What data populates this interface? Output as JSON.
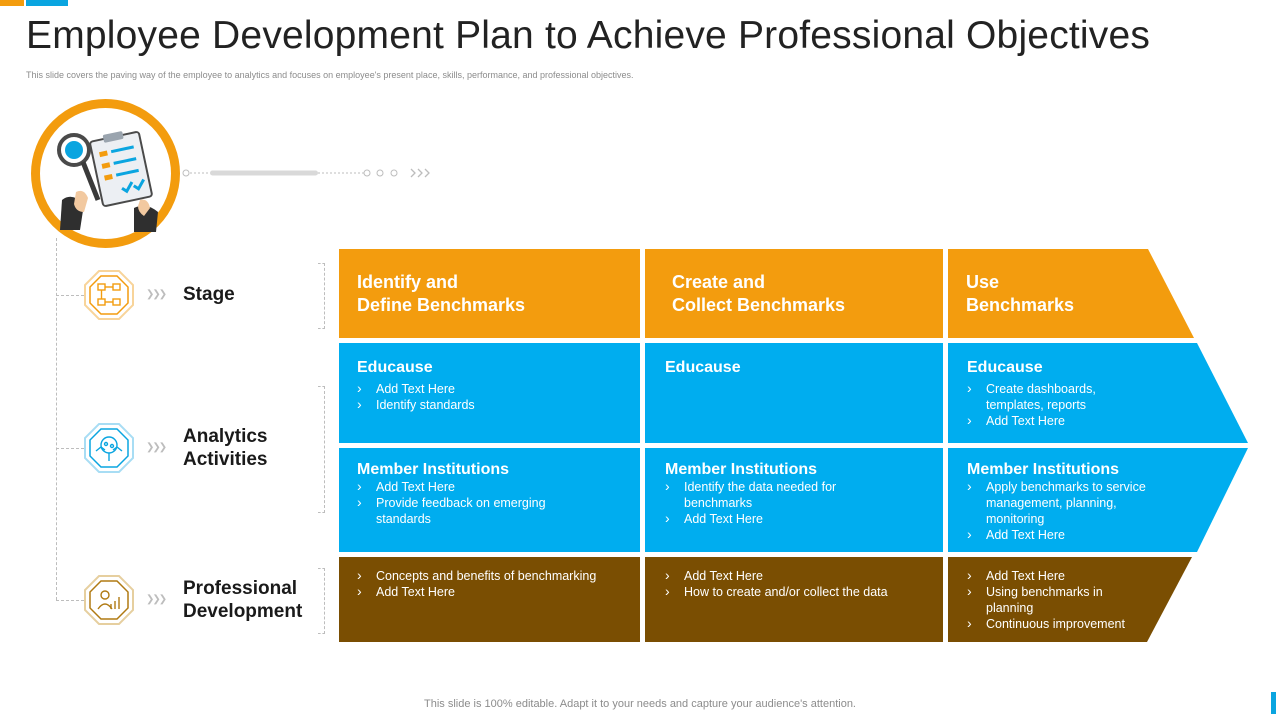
{
  "title": "Employee Development Plan to Achieve Professional Objectives",
  "subtitle": "This slide covers the paving way of the employee to analytics and focuses on employee's present place, skills, performance, and professional objectives.",
  "footer": "This slide is 100% editable. Adapt it to your needs and capture your audience's attention.",
  "colors": {
    "orange": "#f39c0e",
    "blue": "#00adef",
    "brown": "#7a4e02"
  },
  "hero_icon": "clipboard-checklist-magnifier-icon",
  "rows": [
    {
      "label_line1": "Stage",
      "label_line2": "",
      "icon": "flowchart-icon"
    },
    {
      "label_line1": "Analytics",
      "label_line2": "Activities",
      "icon": "analytics-magnifier-icon"
    },
    {
      "label_line1": "Professional",
      "label_line2": "Development",
      "icon": "professional-growth-icon"
    }
  ],
  "stages": [
    {
      "header_line1": "Identify and",
      "header_line2": "Define Benchmarks",
      "educause": {
        "title": "Educause",
        "items": [
          "Add Text Here",
          "Identify standards"
        ]
      },
      "member": {
        "title": "Member Institutions",
        "items": [
          "Add Text Here",
          "Provide  feedback  on  emerging",
          "standards"
        ]
      },
      "development": {
        "items": [
          "Concepts and benefits of benchmarking",
          "Add Text Here"
        ]
      }
    },
    {
      "header_line1": "Create and",
      "header_line2": "Collect Benchmarks",
      "educause": {
        "title": "Educause",
        "items": []
      },
      "member": {
        "title": "Member Institutions",
        "items": [
          "Identify the data needed for",
          "benchmarks",
          "Add Text Here"
        ]
      },
      "development": {
        "items": [
          "Add Text Here",
          "How to create and/or collect the data"
        ]
      }
    },
    {
      "header_line1": "Use",
      "header_line2": "Benchmarks",
      "educause": {
        "title": "Educause",
        "items": [
          "Create dashboards,",
          "templates, reports",
          "Add Text Here"
        ]
      },
      "member": {
        "title": "Member Institutions",
        "items": [
          "Apply benchmarks to service",
          "management,  planning,",
          "monitoring",
          "Add Text Here"
        ]
      },
      "development": {
        "items": [
          "Add Text Here",
          "Using  benchmarks  in",
          "planning",
          "Continuous improvement"
        ]
      }
    }
  ]
}
